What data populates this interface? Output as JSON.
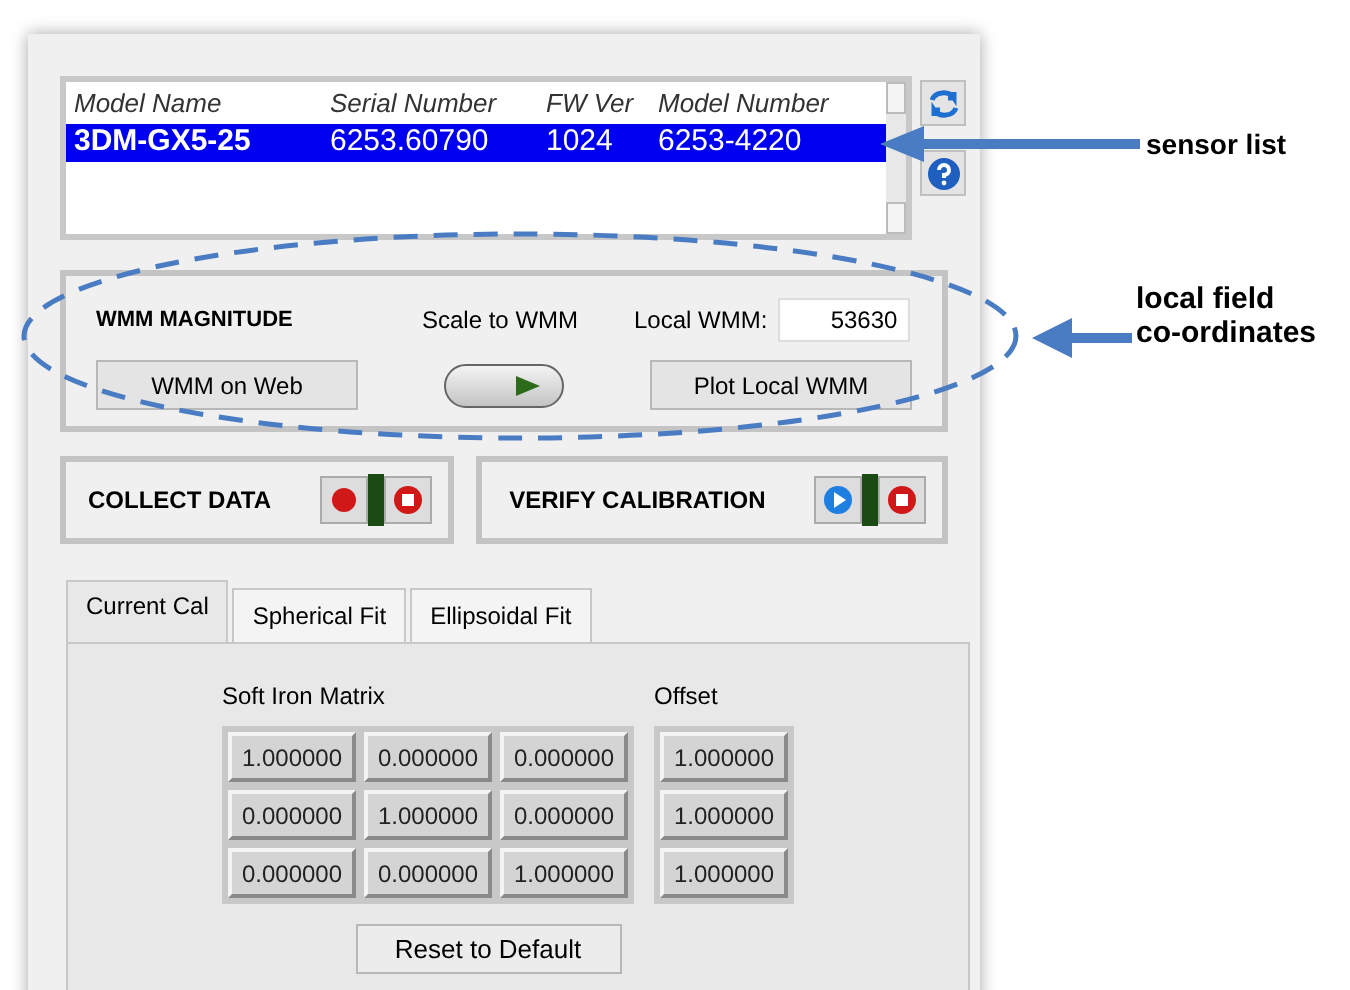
{
  "sensor_list": {
    "columns": [
      "Model Name",
      "Serial Number",
      "FW Ver",
      "Model Number"
    ],
    "rows": [
      {
        "cells": [
          "3DM-GX5-25",
          "6253.60790",
          "1024",
          "6253-4220"
        ],
        "selected": true
      }
    ]
  },
  "wmm": {
    "title": "WMM MAGNITUDE",
    "scale_label": "Scale to WMM",
    "local_label": "Local WMM:",
    "local_value": "53630",
    "scale_on": true,
    "web_button": "WMM on Web",
    "plot_button": "Plot Local WMM"
  },
  "collect": {
    "title": "COLLECT DATA"
  },
  "verify": {
    "title": "VERIFY CALIBRATION"
  },
  "tabs": [
    {
      "label": "Current Cal",
      "selected": true
    },
    {
      "label": "Spherical Fit",
      "selected": false
    },
    {
      "label": "Ellipsoidal Fit",
      "selected": false
    }
  ],
  "matrix": {
    "title": "Soft Iron Matrix",
    "rows": [
      [
        "1.000000",
        "0.000000",
        "0.000000"
      ],
      [
        "0.000000",
        "1.000000",
        "0.000000"
      ],
      [
        "0.000000",
        "0.000000",
        "1.000000"
      ]
    ]
  },
  "offset": {
    "title": "Offset",
    "values": [
      "1.000000",
      "1.000000",
      "1.000000"
    ]
  },
  "reset_button": "Reset to Default",
  "annotations": [
    "sensor list",
    "local field co-ordinates"
  ]
}
